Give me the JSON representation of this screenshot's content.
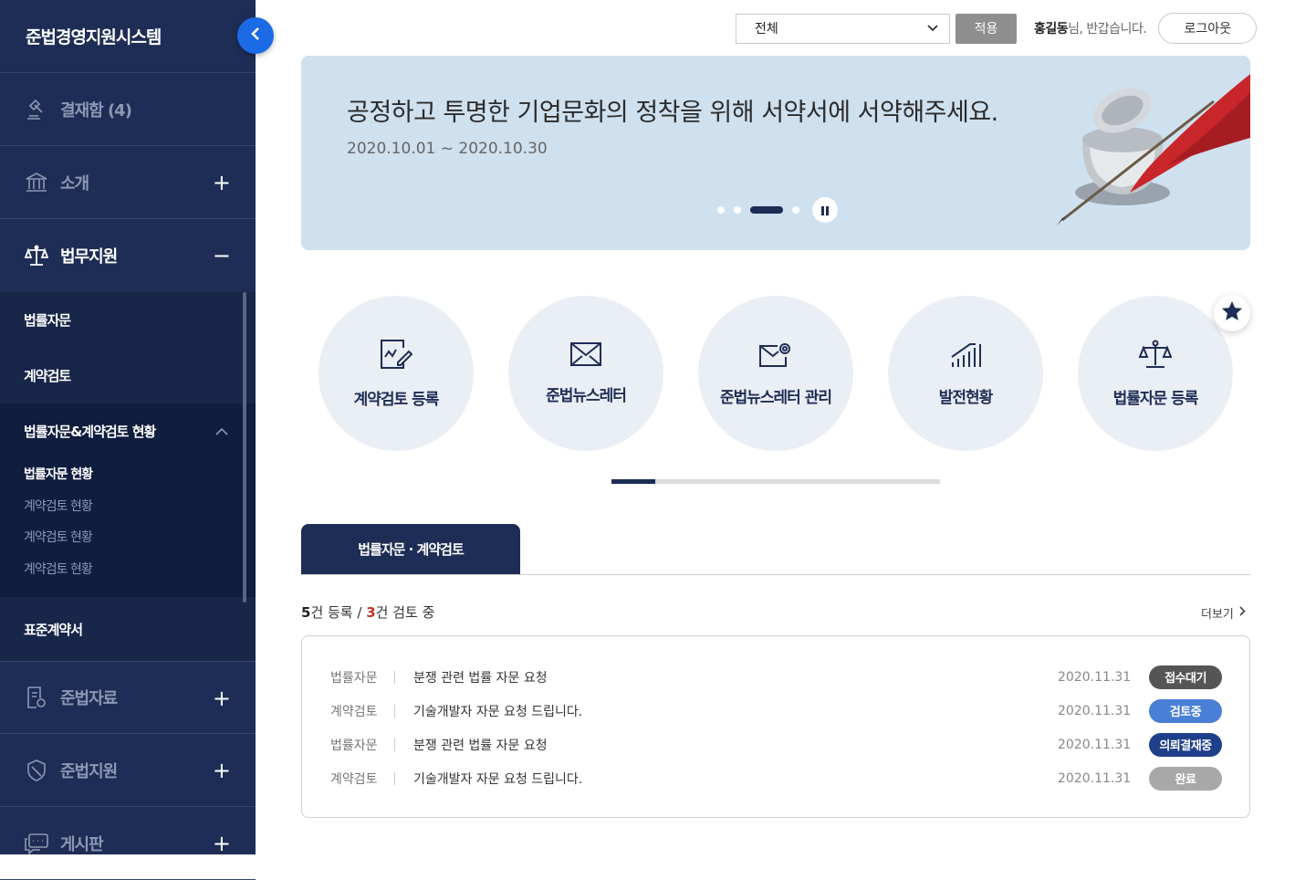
{
  "sidebar": {
    "title": "준법경영지원시스템",
    "approval": "결재함 (4)",
    "menus": [
      {
        "label": "소개",
        "toggle": "+"
      },
      {
        "label": "법무지원",
        "toggle": "−"
      },
      {
        "label": "준법자료",
        "toggle": "+"
      },
      {
        "label": "준법지원",
        "toggle": "+"
      },
      {
        "label": "게시판",
        "toggle": "+"
      }
    ],
    "sub": {
      "item1": "법률자문",
      "item2": "계약검토",
      "item3": "법률자문&계약검토 현황",
      "subsub": [
        "법률자문 현황",
        "계약검토 현황",
        "계약검토 현황",
        "계약검토 현황"
      ],
      "item4": "표준계약서"
    }
  },
  "topbar": {
    "select_value": "전체",
    "apply_label": "적용",
    "user_name": "홍길동",
    "greeting_suffix": "님, 반갑습니다.",
    "logout_label": "로그아웃"
  },
  "banner": {
    "title": "공정하고 투명한 기업문화의 정착을 위해 서약서에 서약해주세요.",
    "date": "2020.10.01 ~ 2020.10.30",
    "slide_count": 4,
    "active_slide": 3
  },
  "quick_menu": [
    {
      "label": "계약검토 등록",
      "icon": "contract-edit-icon"
    },
    {
      "label": "준법뉴스레터",
      "icon": "mail-icon"
    },
    {
      "label": "준법뉴스레터 관리",
      "icon": "mail-settings-icon"
    },
    {
      "label": "발전현황",
      "icon": "growth-chart-icon"
    },
    {
      "label": "법률자문 등록",
      "icon": "scale-icon"
    }
  ],
  "quick_progress": 0.133,
  "tab": {
    "label": "법률자문 · 계약검토"
  },
  "summary": {
    "registered": "5",
    "registered_suffix": "건 등록 / ",
    "reviewing": "3",
    "reviewing_suffix": "건 검토 중"
  },
  "more_label": "더보기",
  "list": [
    {
      "category": "법률자문",
      "title": "분쟁 관련 법률 자문 요청",
      "date": "2020.11.31",
      "status": "접수대기",
      "color": "#555555"
    },
    {
      "category": "계약검토",
      "title": "기술개발자 자문 요청 드립니다.",
      "date": "2020.11.31",
      "status": "검토중",
      "color": "#4a7fd6"
    },
    {
      "category": "법률자문",
      "title": "분쟁 관련 법률 자문 요청",
      "date": "2020.11.31",
      "status": "의뢰결재중",
      "color": "#1e3f8a"
    },
    {
      "category": "계약검토",
      "title": "기술개발자 자문 요청 드립니다.",
      "date": "2020.11.31",
      "status": "완료",
      "color": "#a8a8a8"
    }
  ]
}
